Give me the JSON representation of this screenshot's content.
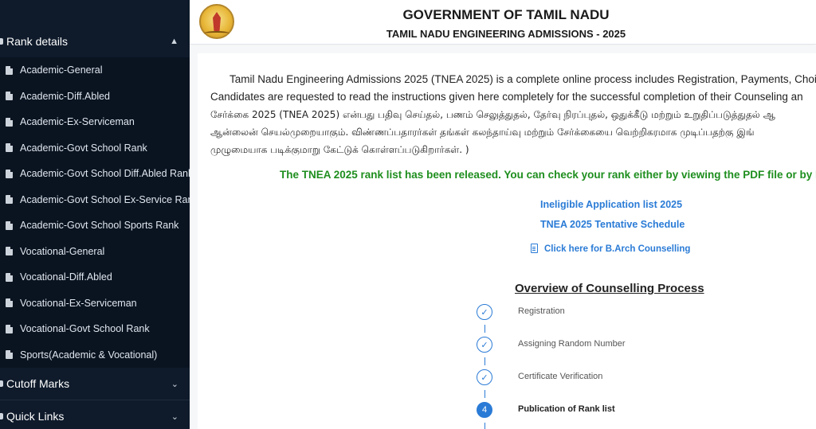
{
  "sidebar": {
    "rank_details": "Rank details",
    "rank_items": [
      "Academic-General",
      "Academic-Diff.Abled",
      "Academic-Ex-Serviceman",
      "Academic-Govt School Rank",
      "Academic-Govt School Diff.Abled Rank",
      "Academic-Govt School Ex-Service Rank",
      "Academic-Govt School Sports Rank",
      "Vocational-General",
      "Vocational-Diff.Abled",
      "Vocational-Ex-Serviceman",
      "Vocational-Govt School Rank",
      "Sports(Academic & Vocational)"
    ],
    "cutoff_marks": "Cutoff Marks",
    "quick_links": "Quick Links"
  },
  "header": {
    "title": "GOVERNMENT OF TAMIL NADU",
    "subtitle": "TAMIL NADU ENGINEERING ADMISSIONS - 2025"
  },
  "main": {
    "intro_lines": [
      "Tamil Nadu Engineering Admissions 2025 (TNEA 2025) is a complete online process includes Registration, Payments, Choic",
      "Candidates are requested to read the instructions given here completely for the successful completion of their Counseling an",
      "சேர்க்கை 2025 (TNEA 2025) என்பது பதிவு செய்தல், பணம் செலுத்துதல், தேர்வு நிரப்புதல், ஒதுக்கீடு மற்றும் உறுதிப்படுத்துதல் ஆ",
      "ஆன்லைன் செயல்முறையாகும். விண்ணப்பதாரர்கள் தங்கள் கலந்தாய்வு மற்றும் சேர்க்கையை வெற்றிகரமாக முடிப்பதற்கு இங்",
      "முழுமையாக படிக்குமாறு கேட்டுக் கொள்ளப்படுகிறார்கள். )"
    ],
    "rank_notice": "The TNEA 2025 rank list has been released. You can check your rank either by viewing the PDF file or by l",
    "link_ineligible": "Ineligible Application list 2025",
    "link_schedule": "TNEA 2025 Tentative Schedule",
    "link_barch": "Click here for B.Arch Counselling",
    "overview_title": "Overview of Counselling Process",
    "steps": [
      {
        "label": "Registration",
        "marker": "✓"
      },
      {
        "label": "Assigning Random Number",
        "marker": "✓"
      },
      {
        "label": "Certificate Verification",
        "marker": "✓"
      },
      {
        "label": "Publication of Rank list",
        "marker": "4"
      }
    ]
  }
}
